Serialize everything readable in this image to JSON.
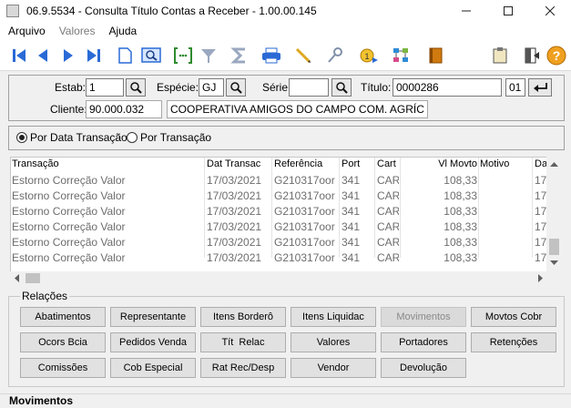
{
  "window": {
    "title": "06.9.5534 - Consulta Título Contas a Receber - 1.00.00.145"
  },
  "menu": [
    {
      "label": "Arquivo",
      "enabled": true
    },
    {
      "label": "Valores",
      "enabled": false
    },
    {
      "label": "Ajuda",
      "enabled": true
    }
  ],
  "toolbar": [
    "first-icon",
    "previous-icon",
    "next-icon",
    "last-icon",
    "new-document-icon",
    "zoom-icon",
    "goto-icon",
    "filter-icon",
    "sigma-icon",
    "print-icon",
    "pencil-icon",
    "key-icon",
    "query-icon",
    "structure-icon",
    "book-icon",
    "clipboard-icon",
    "exit-icon",
    "help-icon"
  ],
  "header": {
    "estab_label": "Estab:",
    "estab_value": "1",
    "especie_label": "Espécie:",
    "especie_value": "GJ",
    "serie_label": "Série:",
    "serie_value": "",
    "titulo_label": "Título:",
    "titulo_value": "0000286",
    "parcela_value": "01",
    "cliente_label": "Cliente:",
    "cliente_code": "90.000.032",
    "cliente_name": "COOPERATIVA AMIGOS DO CAMPO COM. AGRÍC"
  },
  "filter": {
    "option1": "Por Data Transação",
    "option2": "Por Transação",
    "selected": "option1"
  },
  "table": {
    "columns": [
      "Transação",
      "Dat Transac",
      "Referência",
      "Port",
      "Cart",
      "Vl Movto",
      "Motivo",
      "Da"
    ],
    "rows": [
      [
        "Estorno Correção Valor",
        "17/03/2021",
        "G210317oor",
        "341",
        "CAR",
        "108,33",
        "",
        "17"
      ],
      [
        "Estorno Correção Valor",
        "17/03/2021",
        "G210317oor",
        "341",
        "CAR",
        "108,33",
        "",
        "17"
      ],
      [
        "Estorno Correção Valor",
        "17/03/2021",
        "G210317oor",
        "341",
        "CAR",
        "108,33",
        "",
        "17"
      ],
      [
        "Estorno Correção Valor",
        "17/03/2021",
        "G210317oor",
        "341",
        "CAR",
        "108,33",
        "",
        "17"
      ],
      [
        "Estorno Correção Valor",
        "17/03/2021",
        "G210317oor",
        "341",
        "CAR",
        "108,33",
        "",
        "17"
      ],
      [
        "Estorno Correção Valor",
        "17/03/2021",
        "G210317oor",
        "341",
        "CAR",
        "108,33",
        "",
        "17"
      ]
    ]
  },
  "relacoes": {
    "legend": "Relações",
    "buttons": [
      {
        "label": "Abatimentos",
        "enabled": true
      },
      {
        "label": "Representante",
        "enabled": true
      },
      {
        "label": "Itens Borderô",
        "enabled": true
      },
      {
        "label": "Itens Liquidac",
        "enabled": true
      },
      {
        "label": "Movimentos",
        "enabled": false
      },
      {
        "label": "Movtos Cobr",
        "enabled": true
      },
      {
        "label": "Ocors Bcia",
        "enabled": true
      },
      {
        "label": "Pedidos Venda",
        "enabled": true
      },
      {
        "label": "Tít  Relac",
        "enabled": true
      },
      {
        "label": "Valores",
        "enabled": true
      },
      {
        "label": "Portadores",
        "enabled": true
      },
      {
        "label": "Retenções",
        "enabled": true
      },
      {
        "label": "Comissões",
        "enabled": true
      },
      {
        "label": "Cob Especial",
        "enabled": true
      },
      {
        "label": "Rat Rec/Desp",
        "enabled": true
      },
      {
        "label": "Vendor",
        "enabled": true
      },
      {
        "label": "Devolução",
        "enabled": true
      }
    ]
  },
  "status": {
    "text": "Movimentos"
  }
}
